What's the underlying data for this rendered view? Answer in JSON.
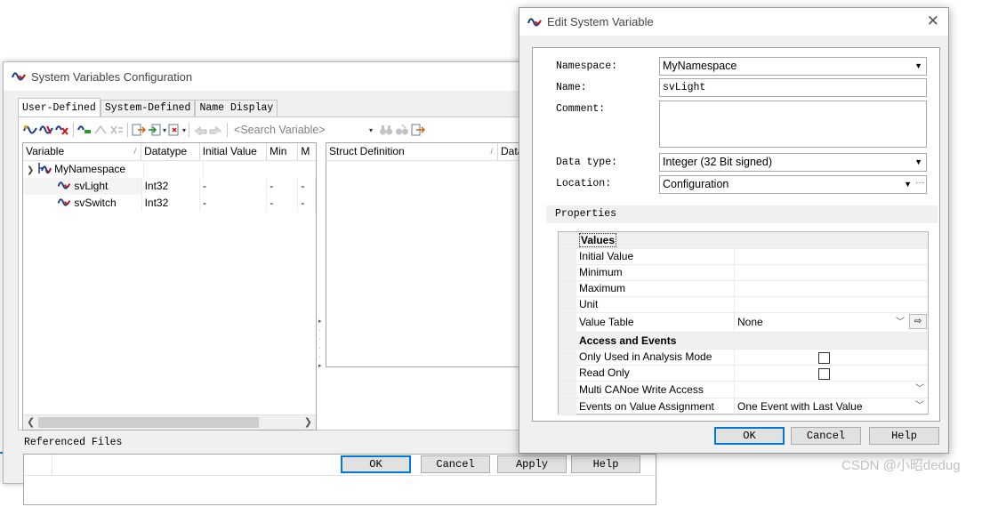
{
  "bg_window": {
    "title": "System Variables Configuration",
    "tabs": [
      {
        "label": "User-Defined",
        "active": true
      },
      {
        "label": "System-Defined",
        "active": false
      },
      {
        "label": "Name Display",
        "active": false
      }
    ],
    "search_placeholder": "<Search Variable>",
    "variables_grid": {
      "columns": [
        "Variable",
        "Datatype",
        "Initial Value",
        "Min",
        "M"
      ],
      "rows": [
        {
          "name": "MyNamespace",
          "type": "namespace",
          "datatype": "",
          "initial": "",
          "min": "",
          "max": ""
        },
        {
          "name": "svLight",
          "type": "variable",
          "datatype": "Int32",
          "initial": "-",
          "min": "-",
          "max": "-"
        },
        {
          "name": "svSwitch",
          "type": "variable",
          "datatype": "Int32",
          "initial": "-",
          "min": "-",
          "max": "-"
        }
      ]
    },
    "struct_grid": {
      "columns": [
        "Struct Definition",
        "Data"
      ]
    },
    "referenced_files_label": "Referenced Files",
    "buttons": {
      "ok": "OK",
      "cancel": "Cancel",
      "apply": "Apply",
      "help": "Help"
    }
  },
  "dialog": {
    "title": "Edit System Variable",
    "labels": {
      "namespace": "Namespace:",
      "name": "Name:",
      "comment": "Comment:",
      "datatype": "Data type:",
      "location": "Location:"
    },
    "values": {
      "namespace": "MyNamespace",
      "name": "svLight",
      "comment": "",
      "datatype": "Integer (32 Bit signed)",
      "location": "Configuration"
    },
    "properties_label": "Properties",
    "properties": {
      "values_category": "Values",
      "initial_value": "Initial Value",
      "minimum": "Minimum",
      "maximum": "Maximum",
      "unit": "Unit",
      "value_table": "Value Table",
      "value_table_value": "None",
      "access_category": "Access and Events",
      "only_analysis": "Only Used in Analysis Mode",
      "only_analysis_checked": false,
      "read_only": "Read Only",
      "read_only_checked": false,
      "multi_canoe": "Multi CANoe Write Access",
      "events_on_assign": "Events on Value Assignment",
      "events_on_assign_value": "One Event with Last Value"
    },
    "buttons": {
      "ok": "OK",
      "cancel": "Cancel",
      "help": "Help"
    }
  },
  "watermark": "CSDN @小昭dedug",
  "colors": {
    "accent": "#0078d7",
    "app_icon_blue": "#1a3a8a",
    "app_icon_red": "#d01010"
  }
}
